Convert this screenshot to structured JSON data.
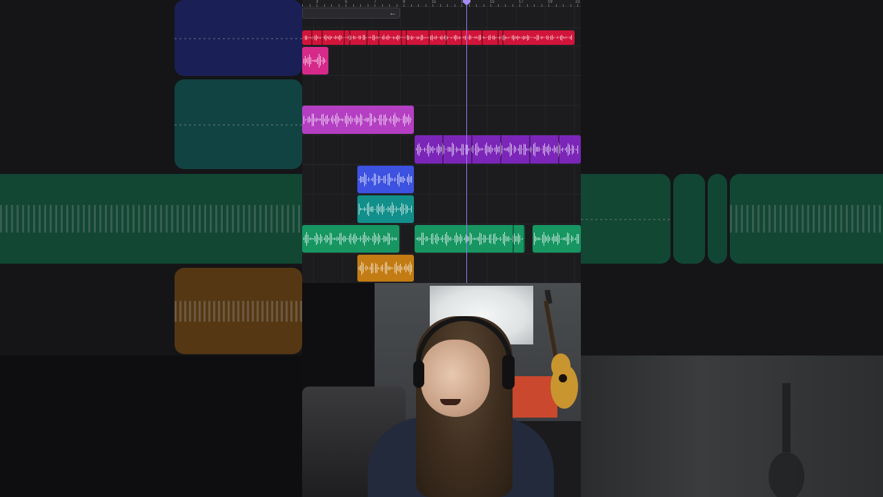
{
  "ruler": {
    "labels": [
      "3",
      "5",
      "7",
      "9",
      "11",
      "13",
      "15",
      "17",
      "19",
      "21"
    ]
  },
  "loop_region": {
    "arrow_icon": "left-arrow-icon",
    "arrow_glyph": "←"
  },
  "tracks": [
    {
      "name": "track-1",
      "color": "#d1153a"
    },
    {
      "name": "track-2",
      "color": "#d62a8a"
    },
    {
      "name": "track-3",
      "color": "#2a2a2e"
    },
    {
      "name": "track-4",
      "color": "#b43fc2"
    },
    {
      "name": "track-5",
      "color": "#7b26b8"
    },
    {
      "name": "track-6",
      "color": "#3d52e0"
    },
    {
      "name": "track-7",
      "color": "#128f8a"
    },
    {
      "name": "track-8",
      "color": "#179662"
    },
    {
      "name": "track-9",
      "color": "#c27c13"
    }
  ],
  "colors": {
    "daw_background": "#1c1c1f",
    "playhead": "#9b7cf0",
    "accent_purple": "#a58af5"
  },
  "webcam": {
    "content": "presenter-webcam-feed"
  }
}
